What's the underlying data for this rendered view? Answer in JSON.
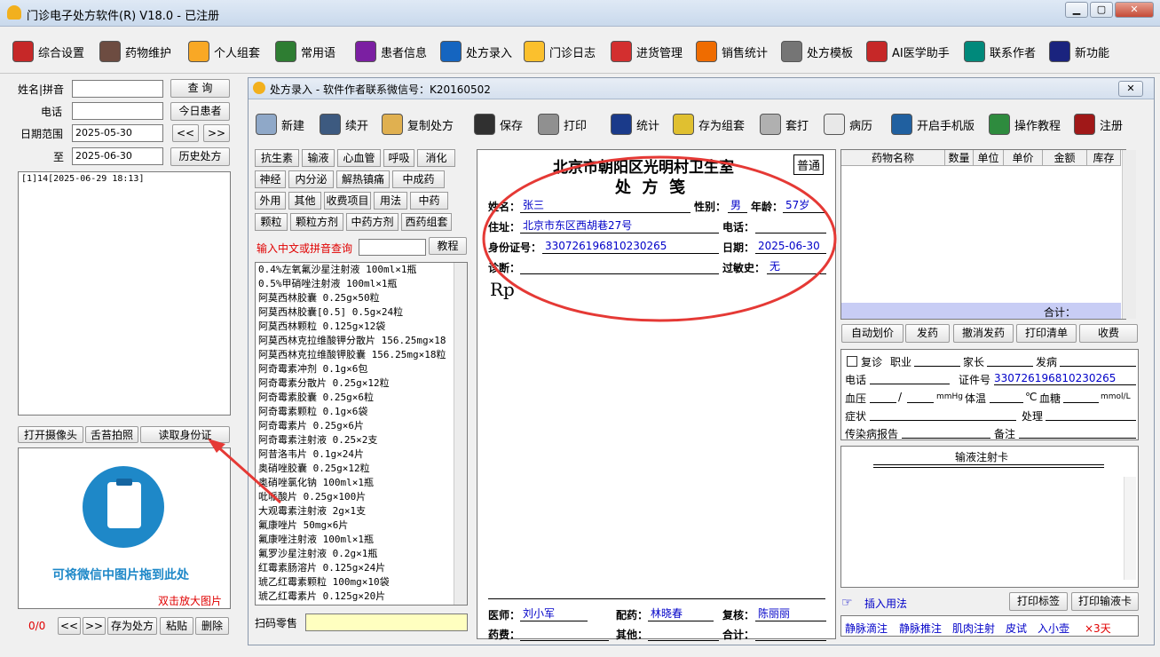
{
  "app": {
    "title": "门诊电子处方软件(R)  V18.0  - 已注册"
  },
  "toolbar": [
    {
      "label": "综合设置",
      "icon": "disc-icon",
      "color": "#c62828"
    },
    {
      "label": "药物维护",
      "icon": "pill-box-icon",
      "color": "#6d4c41"
    },
    {
      "label": "个人组套",
      "icon": "notepad-icon",
      "color": "#f9a825"
    },
    {
      "label": "常用语",
      "icon": "chart-book-icon",
      "color": "#2e7d32"
    },
    {
      "label": "患者信息",
      "icon": "patient-icon",
      "color": "#7b1fa2"
    },
    {
      "label": "处方录入",
      "icon": "pen-paper-icon",
      "color": "#1565c0"
    },
    {
      "label": "门诊日志",
      "icon": "log-icon",
      "color": "#fbc02d"
    },
    {
      "label": "进货管理",
      "icon": "bar-chart-icon",
      "color": "#d32f2f"
    },
    {
      "label": "销售统计",
      "icon": "stats-icon",
      "color": "#ef6c00"
    },
    {
      "label": "处方模板",
      "icon": "template-icon",
      "color": "#757575"
    },
    {
      "label": "AI医学助手",
      "icon": "ai-assistant-icon",
      "color": "#c62828"
    },
    {
      "label": "联系作者",
      "icon": "contact-icon",
      "color": "#00897b"
    },
    {
      "label": "新功能",
      "icon": "butterfly-icon",
      "color": "#1a237e"
    }
  ],
  "left": {
    "name_label": "姓名|拼音",
    "phone_label": "电话",
    "date_range_label": "日期范围",
    "to_label": "至",
    "search_btn": "查  询",
    "today_btn": "今日患者",
    "prev_btn": "<<",
    "next_btn": ">>",
    "history_btn": "历史处方",
    "date_from": "2025-05-30",
    "date_to": "2025-06-30",
    "record": "[1]14[2025-06-29 18:13]",
    "camera_btn": "打开摄像头",
    "tongue_btn": "舌苔拍照",
    "idcard_btn": "读取身份证",
    "drop_hint": "可将微信中图片拖到此处",
    "dblclick_hint": "双击放大图片",
    "page_count": "0/0",
    "nav_prev": "<<",
    "nav_next": ">>",
    "save_rx_btn": "存为处方",
    "paste_btn": "粘贴",
    "delete_btn": "删除"
  },
  "child": {
    "title": "处方录入 - 软件作者联系微信号：K20160502",
    "close": "✕",
    "tools": [
      {
        "label": "新建",
        "icon": "new-icon"
      },
      {
        "label": "续开",
        "icon": "continue-icon"
      },
      {
        "label": "复制处方",
        "icon": "folder-icon"
      },
      {
        "label": "保存",
        "icon": "save-icon"
      },
      {
        "label": "打印",
        "icon": "printer-icon"
      },
      {
        "label": "统计",
        "icon": "statistics-icon"
      },
      {
        "label": "存为组套",
        "icon": "save-set-icon"
      },
      {
        "label": "套打",
        "icon": "overprint-icon"
      },
      {
        "label": "病历",
        "icon": "record-icon"
      },
      {
        "label": "开启手机版",
        "icon": "mobile-icon"
      },
      {
        "label": "操作教程",
        "icon": "help-icon"
      },
      {
        "label": "注册",
        "icon": "register-icon"
      }
    ],
    "categories": [
      [
        "抗生素",
        "输液",
        "心血管",
        "呼吸",
        "消化"
      ],
      [
        "神经",
        "内分泌",
        "解热镇痛",
        "中成药"
      ],
      [
        "外用",
        "其他",
        "收费项目",
        "用法",
        "中药"
      ],
      [
        "颗粒",
        "颗粒方剂",
        "中药方剂",
        "西药组套"
      ]
    ],
    "query_label": "输入中文或拼音查询",
    "tutorial_btn": "教程",
    "drugs": [
      "0.4%左氧氟沙星注射液 100ml×1瓶",
      "0.5%甲硝唑注射液 100ml×1瓶",
      "阿莫西林胶囊 0.25g×50粒",
      "阿莫西林胶囊[0.5] 0.5g×24粒",
      "阿莫西林颗粒 0.125g×12袋",
      "阿莫西林克拉维酸钾分散片 156.25mg×18",
      "阿莫西林克拉维酸钾胶囊 156.25mg×18粒",
      "阿奇霉素冲剂 0.1g×6包",
      "阿奇霉素分散片 0.25g×12粒",
      "阿奇霉素胶囊 0.25g×6粒",
      "阿奇霉素颗粒 0.1g×6袋",
      "阿奇霉素片 0.25g×6片",
      "阿奇霉素注射液 0.25×2支",
      "阿昔洛韦片 0.1g×24片",
      "奥硝唑胶囊 0.25g×12粒",
      "奥硝唑氯化钠 100ml×1瓶",
      "吡哌酸片 0.25g×100片",
      "大观霉素注射液 2g×1支",
      "氟康唑片 50mg×6片",
      "氟康唑注射液 100ml×1瓶",
      "氟罗沙星注射液 0.2g×1瓶",
      "红霉素肠溶片 0.125g×24片",
      "琥乙红霉素颗粒 100mg×10袋",
      "琥乙红霉素片 0.125g×20片"
    ],
    "scan_label": "扫码零售"
  },
  "rx": {
    "hospital": "北京市朝阳区光明村卫生室",
    "type_badge": "普通",
    "title": "处  方  笺",
    "name_label": "姓名：",
    "name": "张三",
    "sex_label": "性别：",
    "sex": "男",
    "age_label": "年龄：",
    "age": "57岁",
    "addr_label": "住址：",
    "addr": "北京市东区西胡巷27号",
    "phone_label": "电话：",
    "phone": "",
    "id_label": "身份证号：",
    "id": "330726196810230265",
    "date_label": "日期：",
    "date": "2025-06-30",
    "diag_label": "诊断：",
    "diag": "",
    "allergy_label": "过敏史：",
    "allergy": "无",
    "rp": "Rp",
    "doctor_label": "医师：",
    "doctor": "刘小军",
    "pharm_label": "配药：",
    "pharm": "林晓春",
    "check_label": "复核：",
    "check": "陈丽丽",
    "fee_label": "药费：",
    "fee": "",
    "other_label": "其他：",
    "other": "",
    "total_label": "合计：",
    "total": ""
  },
  "right": {
    "cols": [
      "药物名称",
      "数量",
      "单位",
      "单价",
      "金额",
      "库存"
    ],
    "sum_label": "合计：",
    "buttons": [
      "自动划价",
      "发药",
      "撤消发药",
      "打印清单",
      "收费"
    ],
    "revisit": "复诊",
    "job": "职业",
    "parent": "家长",
    "onset": "发病",
    "phone": "电话",
    "cert": "证件号",
    "cert_val": "330726196810230265",
    "bp": "血压",
    "slash": "/",
    "mmhg": "mmHg",
    "temp": "体温",
    "celsius": "℃",
    "sugar": "血糖",
    "mmol": "mmol/L",
    "symptom": "症状",
    "treat": "处理",
    "infect": "传染病报告",
    "remark": "备注",
    "infusion_title": "输液注射卡",
    "insert_usage": "插入用法",
    "print_label_btn": "打印标签",
    "print_infusion_btn": "打印输液卡",
    "usages": [
      "静脉滴注",
      "静脉推注",
      "肌肉注射",
      "皮试",
      "入小壶",
      "×3天"
    ]
  },
  "colors": {
    "annotation": "#e53935",
    "link": "#0000c8",
    "query": "#e00000",
    "drop_hint": "#1e88c8"
  }
}
